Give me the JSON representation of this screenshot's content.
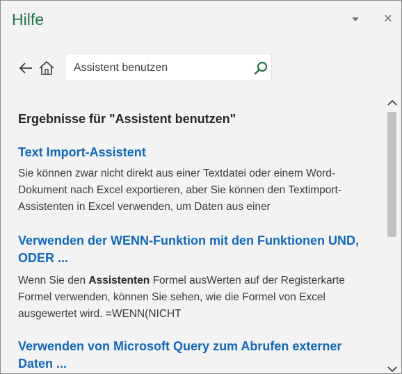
{
  "pane": {
    "title": "Hilfe",
    "close_symbol": "×",
    "menu_icon": "dropdown-arrow-icon"
  },
  "nav": {
    "back_icon": "back-arrow-icon",
    "home_icon": "home-icon"
  },
  "search": {
    "value": "Assistent benutzen",
    "icon": "search-icon"
  },
  "results": {
    "heading": "Ergebnisse für \"Assistent benutzen\"",
    "items": [
      {
        "title": "Text Import-Assistent",
        "snippet": "Sie können zwar nicht direkt aus einer Textdatei oder einem Word-Dokument nach Excel exportieren, aber Sie können den Textimport-Assistenten in Excel verwenden, um Daten aus einer"
      },
      {
        "title": "Verwenden der WENN-Funktion mit den Funktionen UND, ODER ...",
        "snippet_pre": "Wenn Sie den ",
        "snippet_bold": "Assistenten",
        "snippet_post": " Formel ausWerten auf der Registerkarte Formel verwenden, können Sie sehen, wie die Formel von Excel ausgewertet wird. =WENN(NICHT"
      },
      {
        "title": "Verwenden von Microsoft Query zum Abrufen externer Daten ..."
      }
    ]
  },
  "colors": {
    "title_green": "#217346",
    "link_blue": "#1267bb",
    "pane_bg": "#f3f3f3"
  }
}
